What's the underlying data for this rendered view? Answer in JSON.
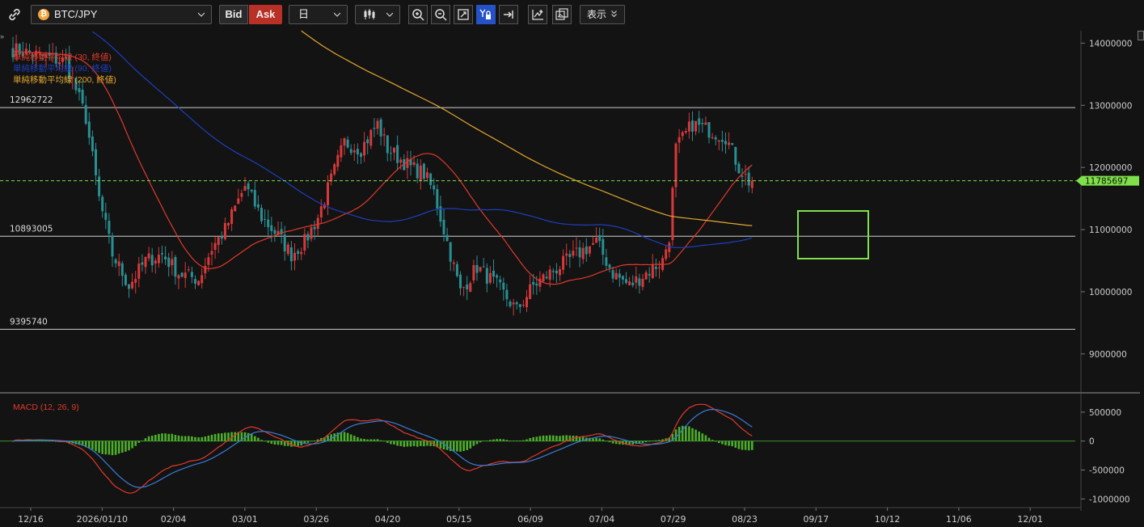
{
  "toolbar": {
    "symbol": "BTC/JPY",
    "bid_label": "Bid",
    "ask_label": "Ask",
    "interval": "日",
    "display_label": "表示"
  },
  "colors": {
    "background": "#131313",
    "up": "#d9383a",
    "down": "#2a8f93",
    "ma30": "#e0392b",
    "ma90": "#1d3fbd",
    "ma200": "#e3a72f",
    "macd_line": "#e0392b",
    "signal_line": "#3a7bd5",
    "histogram": "#4caf2a",
    "price_marker": "#7ee04a"
  },
  "legend": [
    {
      "text": "単純移動平均線 (30, 終値)",
      "color": "#e0392b"
    },
    {
      "text": "単純移動平均線 (90, 終値)",
      "color": "#1d3fbd"
    },
    {
      "text": "単純移動平均線 (200, 終値)",
      "color": "#e3a72f"
    }
  ],
  "macd_label": "MACD (12, 26, 9)",
  "chart_data": [
    {
      "type": "candlestick",
      "title": "",
      "x_ticks": [
        "12/16",
        "2026/01/10",
        "02/04",
        "03/01",
        "03/26",
        "04/20",
        "05/15",
        "06/09",
        "07/04",
        "07/29",
        "08/23",
        "09/17",
        "10/12",
        "11/06",
        "12/01"
      ],
      "y_ticks": [
        "14000000",
        "13000000",
        "12000000",
        "11000000",
        "10000000",
        "9000000"
      ],
      "ylim": [
        8400000,
        14200000
      ],
      "horizontal_lines": [
        {
          "label": "12962722",
          "value": 12962722
        },
        {
          "label": "10893005",
          "value": 10893005
        },
        {
          "label": "9395740",
          "value": 9395740
        }
      ],
      "current_price": {
        "label": "11785697",
        "value": 11785697
      },
      "close_path": [
        [
          0,
          13900000
        ],
        [
          16,
          13700000
        ],
        [
          22,
          12800000
        ],
        [
          26,
          11500000
        ],
        [
          30,
          10600000
        ],
        [
          35,
          10100000
        ],
        [
          40,
          10500000
        ],
        [
          45,
          10600000
        ],
        [
          50,
          10300000
        ],
        [
          56,
          10200000
        ],
        [
          60,
          10700000
        ],
        [
          64,
          11000000
        ],
        [
          70,
          11700000
        ],
        [
          75,
          11200000
        ],
        [
          80,
          10900000
        ],
        [
          84,
          10600000
        ],
        [
          88,
          10800000
        ],
        [
          92,
          11200000
        ],
        [
          96,
          11800000
        ],
        [
          100,
          12400000
        ],
        [
          105,
          12300000
        ],
        [
          110,
          12700000
        ],
        [
          113,
          12300000
        ],
        [
          120,
          12000000
        ],
        [
          124,
          11900000
        ],
        [
          127,
          11600000
        ],
        [
          131,
          10800000
        ],
        [
          135,
          10000000
        ],
        [
          140,
          10400000
        ],
        [
          146,
          10100000
        ],
        [
          152,
          9700000
        ],
        [
          157,
          10100000
        ],
        [
          162,
          10300000
        ],
        [
          170,
          10600000
        ],
        [
          176,
          10800000
        ],
        [
          181,
          10300000
        ],
        [
          186,
          10100000
        ],
        [
          191,
          10300000
        ],
        [
          196,
          10500000
        ],
        [
          198,
          10900000
        ],
        [
          200,
          12300000
        ],
        [
          205,
          12700000
        ],
        [
          210,
          12600000
        ],
        [
          215,
          12500000
        ],
        [
          219,
          12000000
        ],
        [
          223,
          11700000
        ]
      ],
      "macd": {
        "ylim": [
          -1150000,
          750000
        ],
        "y_ticks": [
          "500000",
          "0",
          "-500000",
          "-1000000"
        ]
      }
    }
  ]
}
